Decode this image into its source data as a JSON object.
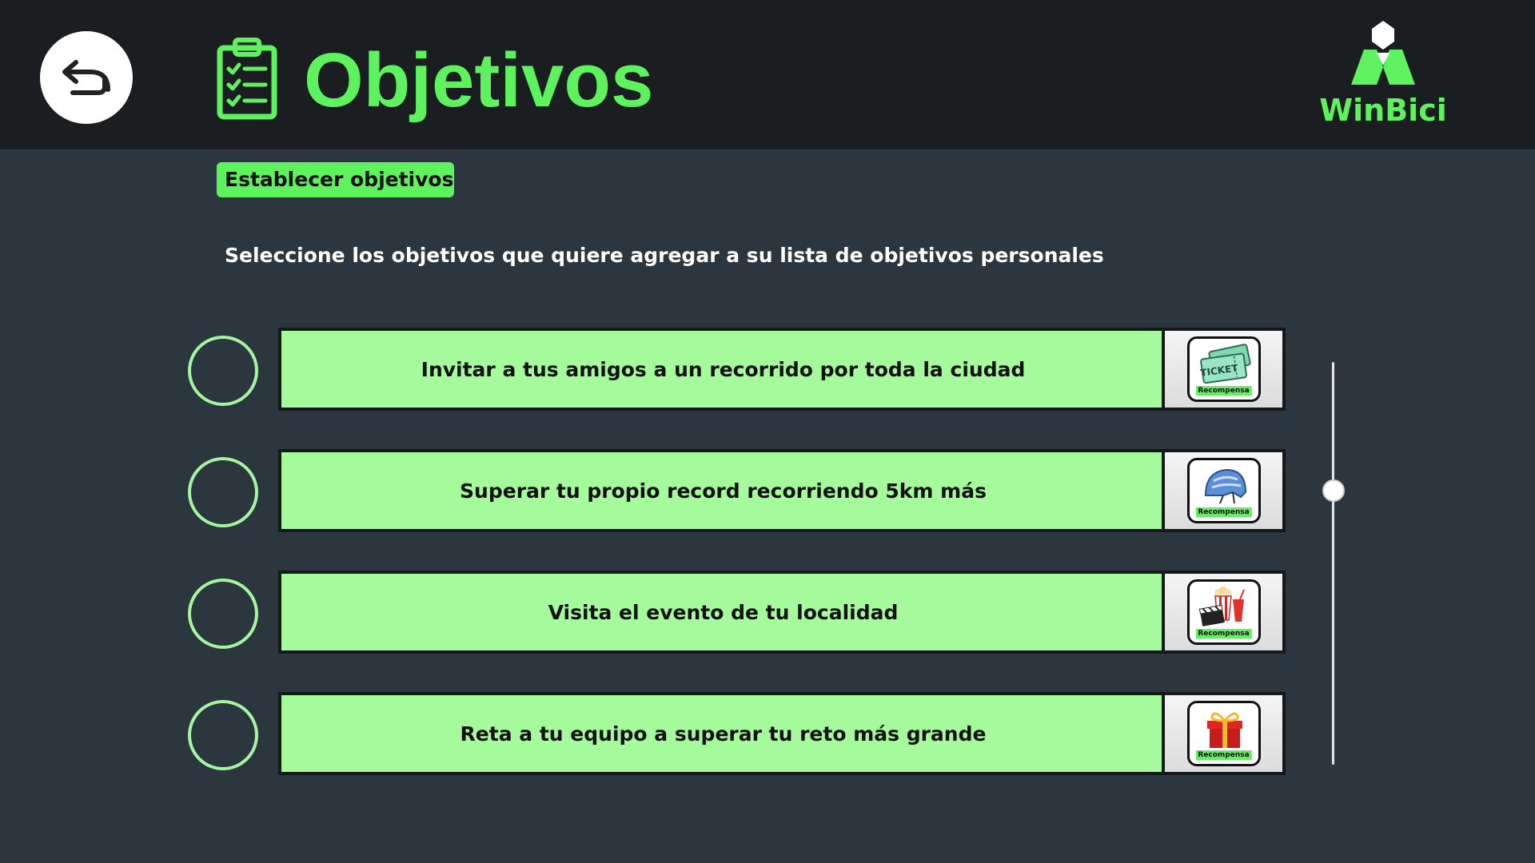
{
  "header": {
    "title": "Objetivos",
    "title_icon": "clipboard-checklist-icon",
    "back_icon": "back-arrow-icon",
    "brand": "WinBici",
    "brand_icon": "winbici-logo-icon"
  },
  "section": {
    "label": "Establecer objetivos",
    "instructions": "Seleccione los objetivos que quiere agregar a su lista de objetivos personales"
  },
  "goals": [
    {
      "label": "Invitar a tus amigos a un recorrido por toda la ciudad",
      "reward_label": "Recompensa",
      "reward_icon": "ticket-icon",
      "selected": false
    },
    {
      "label": "Superar tu propio record recorriendo 5km más",
      "reward_label": "Recompensa",
      "reward_icon": "bike-helmet-icon",
      "selected": false
    },
    {
      "label": "Visita el evento de tu localidad",
      "reward_label": "Recompensa",
      "reward_icon": "movie-popcorn-icon",
      "selected": false
    },
    {
      "label": "Reta a tu equipo a superar tu reto más grande",
      "reward_label": "Recompensa",
      "reward_icon": "gift-box-icon",
      "selected": false
    }
  ],
  "scroll": {
    "position_fraction": 0.3
  },
  "colors": {
    "accent": "#5ef25e",
    "card": "#a5fa9c",
    "header_bg": "#1b1e21",
    "page_bg": "#2c363e"
  }
}
